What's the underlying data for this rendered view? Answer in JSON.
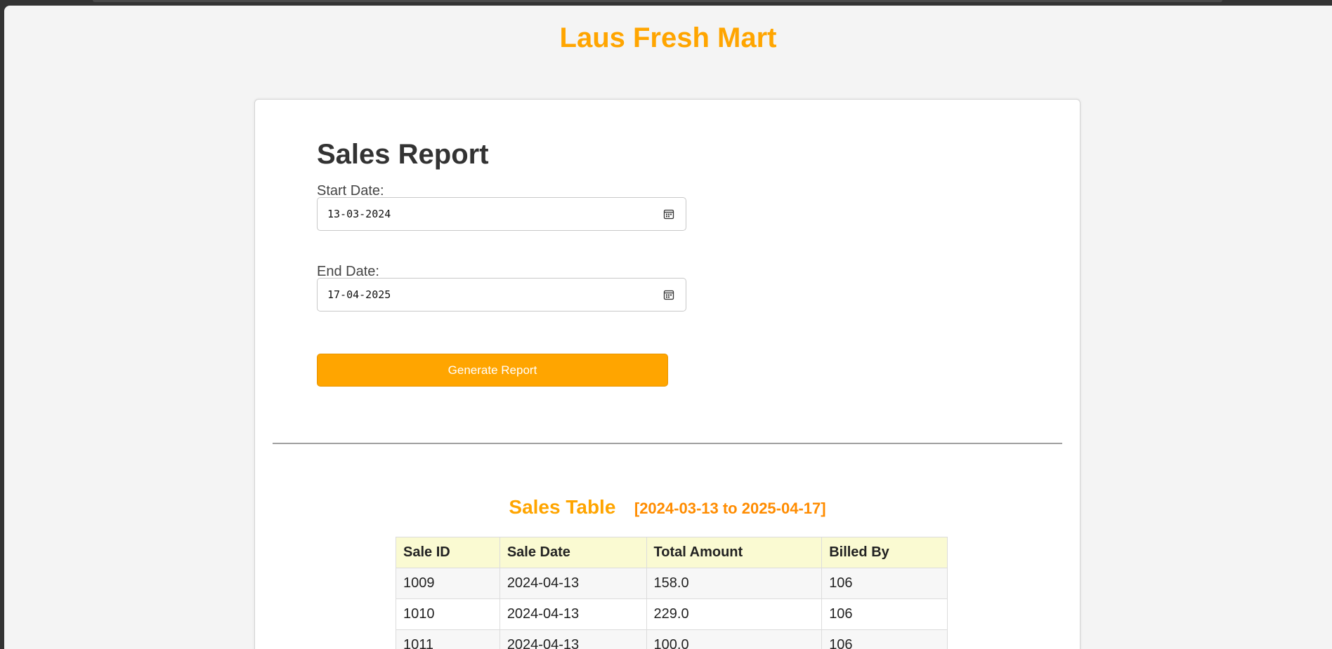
{
  "app": {
    "title": "Laus Fresh Mart"
  },
  "form": {
    "heading": "Sales Report",
    "start_date_label": "Start Date:",
    "start_date_value": "13-03-2024",
    "end_date_label": "End Date:",
    "end_date_value": "17-04-2025",
    "generate_button": "Generate Report"
  },
  "table": {
    "title": "Sales Table",
    "range": "[2024-03-13 to 2025-04-17]",
    "headers": [
      "Sale ID",
      "Sale Date",
      "Total Amount",
      "Billed By"
    ],
    "rows": [
      [
        "1009",
        "2024-04-13",
        "158.0",
        "106"
      ],
      [
        "1010",
        "2024-04-13",
        "229.0",
        "106"
      ],
      [
        "1011",
        "2024-04-13",
        "100.0",
        "106"
      ]
    ]
  },
  "icons": {
    "start_date_icon": "calendar-icon",
    "end_date_icon": "calendar-icon"
  },
  "colors": {
    "accent": "#ffa500",
    "range_text": "#ff8c00",
    "header_bg": "#fafad2",
    "heading_text": "#333333"
  }
}
